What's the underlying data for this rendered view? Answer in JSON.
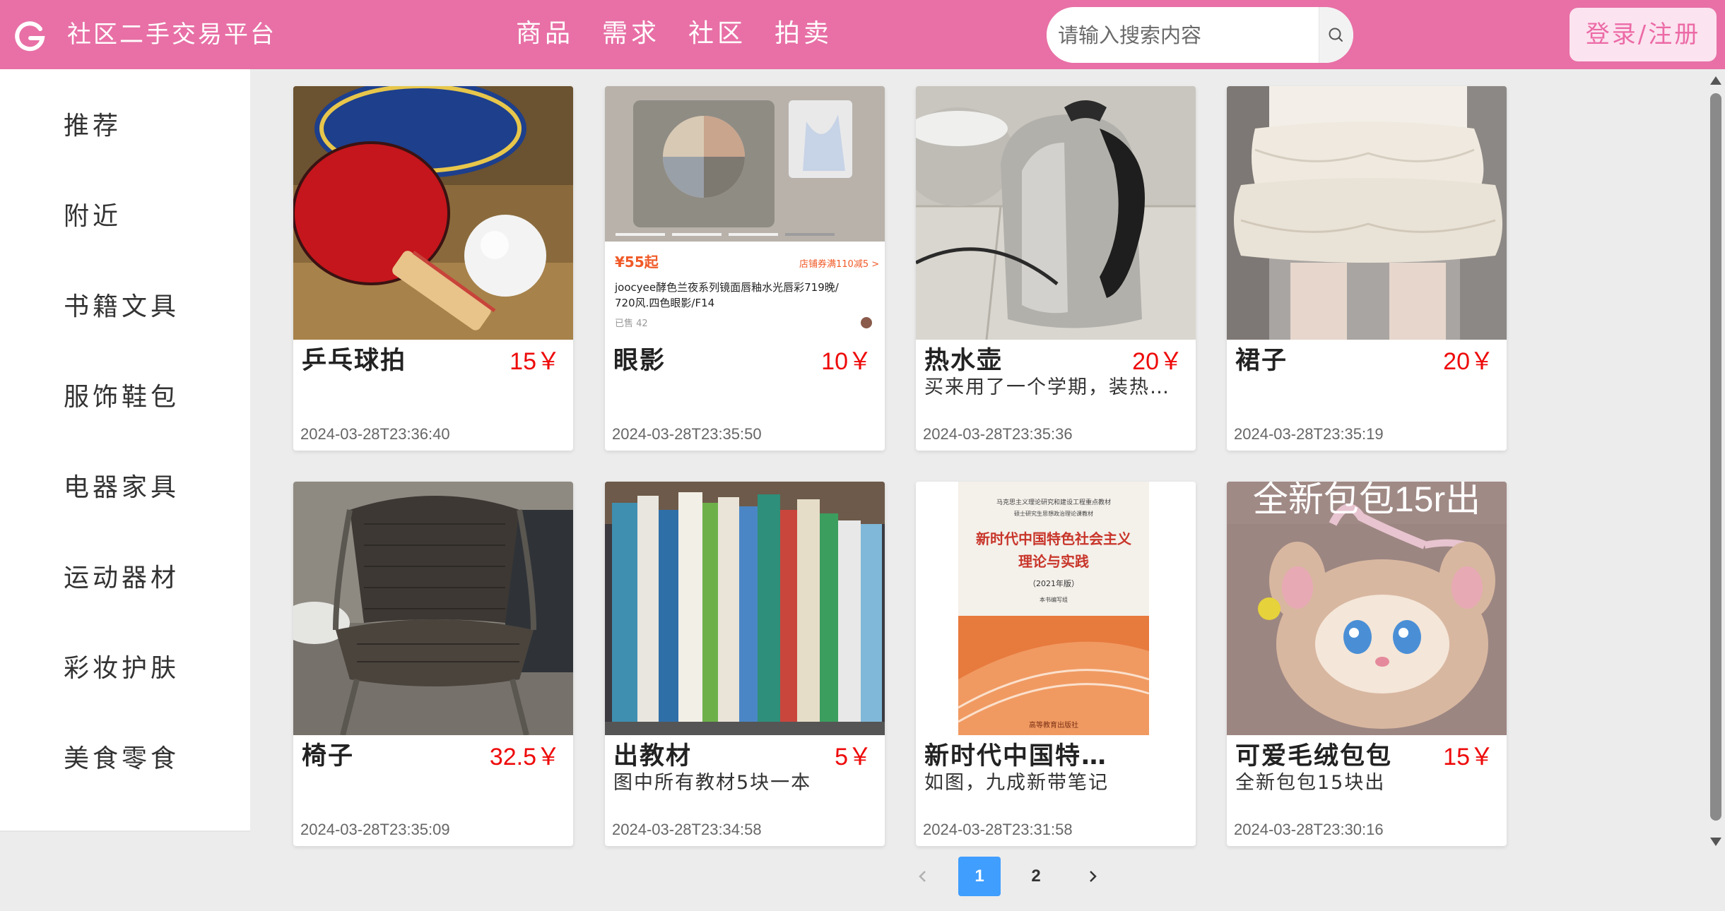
{
  "header": {
    "app_title": "社区二手交易平台",
    "nav": [
      "商品",
      "需求",
      "社区",
      "拍卖"
    ],
    "search_placeholder": "请输入搜索内容",
    "login_label": "登录/注册",
    "brand_color": "#e870a6"
  },
  "sidebar": {
    "items": [
      "推荐",
      "附近",
      "书籍文具",
      "服饰鞋包",
      "电器家具",
      "运动器材",
      "彩妆护肤",
      "美食零食"
    ]
  },
  "products": [
    {
      "title": "乒乓球拍",
      "price": "15￥",
      "desc": "",
      "time": "2024-03-28T23:36:40",
      "image": "ping-pong-paddle-photo"
    },
    {
      "title": "眼影",
      "price": "10￥",
      "desc": "",
      "time": "2024-03-28T23:35:50",
      "image": "eyeshadow-palette-photo",
      "image_text": {
        "price": "¥55起",
        "coupon": "店铺券满110减5 >",
        "name": "joocyee酵色兰夜系列镜面唇釉水光唇彩719晚/720风.四色眼影/F14",
        "sold": "已售 42"
      }
    },
    {
      "title": "热水壶",
      "price": "20￥",
      "desc": "买来用了一个学期，装热水的",
      "time": "2024-03-28T23:35:36",
      "image": "electric-kettle-photo"
    },
    {
      "title": "裙子",
      "price": "20￥",
      "desc": "",
      "time": "2024-03-28T23:35:19",
      "image": "white-skirt-photo"
    },
    {
      "title": "椅子",
      "price": "32.5￥",
      "desc": "",
      "time": "2024-03-28T23:35:09",
      "image": "rattan-chair-photo"
    },
    {
      "title": "出教材",
      "price": "5￥",
      "desc": "图中所有教材5块一本",
      "time": "2024-03-28T23:34:58",
      "image": "textbooks-photo"
    },
    {
      "title": "新时代中国特色社会主义理论与实践",
      "price": "",
      "desc": "如图，九成新带笔记",
      "time": "2024-03-28T23:31:58",
      "image": "book-cover-photo",
      "image_text": {
        "top": "马克思主义理论研究和建设工程重点教材",
        "sub": "硕士研究生思想政治理论课教材",
        "title": "新时代中国特色社会主义理论与实践",
        "edition": "（2021年版）",
        "editor": "本书编写组",
        "publisher": "高等教育出版社"
      }
    },
    {
      "title": "可爱毛绒包包",
      "price": "15￥",
      "desc": "全新包包15块出",
      "time": "2024-03-28T23:30:16",
      "image": "plush-bag-photo",
      "image_text": {
        "overlay": "全新包包15r出"
      }
    }
  ],
  "pagination": {
    "pages": [
      "1",
      "2"
    ],
    "current": "1",
    "active_color": "#409eff"
  },
  "colors": {
    "price": "#ee0a0a",
    "login_bg": "#fbe3ef",
    "login_text": "#ec6aa6"
  }
}
